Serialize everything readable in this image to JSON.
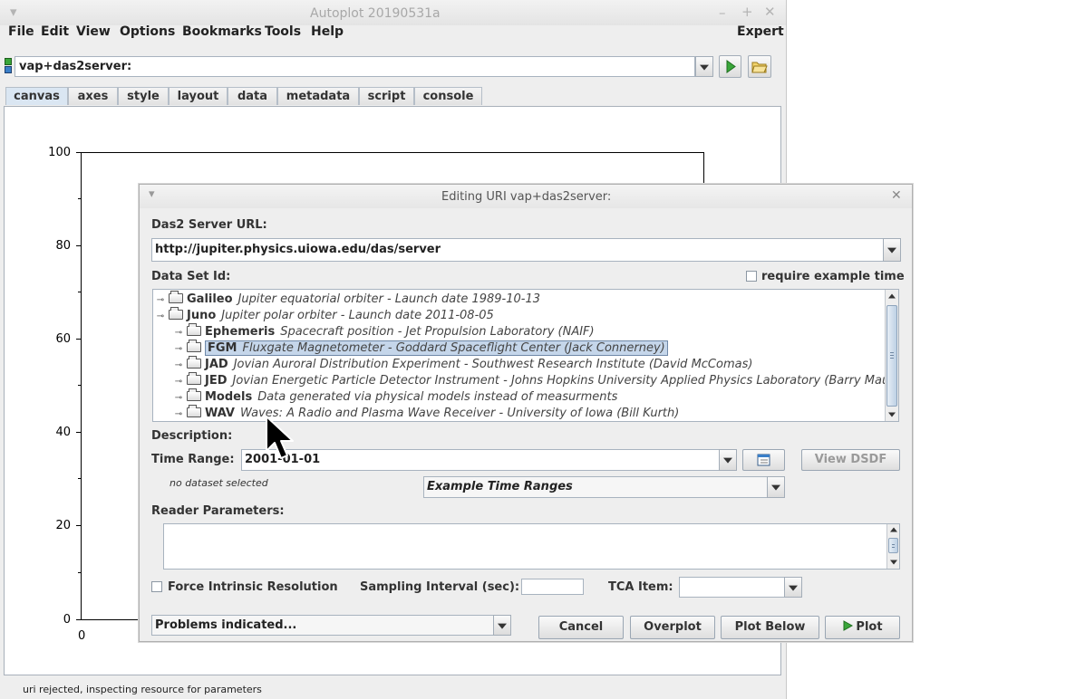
{
  "main_window": {
    "title": "Autoplot 20190531a",
    "menu": [
      "File",
      "Edit",
      "View",
      "Options",
      "Bookmarks",
      "Tools",
      "Help"
    ],
    "expert_label": "Expert",
    "uri_value": "vap+das2server:",
    "tabs": [
      "canvas",
      "axes",
      "style",
      "layout",
      "data",
      "metadata",
      "script",
      "console"
    ],
    "active_tab": "canvas",
    "plot": {
      "y_ticks": [
        "100",
        "80",
        "60",
        "40",
        "20",
        "0"
      ],
      "x_ticks": [
        "0"
      ]
    },
    "status": "uri rejected, inspecting resource for parameters"
  },
  "dialog": {
    "title": "Editing URI vap+das2server:",
    "server_url_label": "Das2 Server URL:",
    "server_url_value": "http://jupiter.physics.uiowa.edu/das/server",
    "dataset_id_label": "Data Set Id:",
    "require_example_time_label": "require example time",
    "tree": [
      {
        "key": "Galileo",
        "desc": "Jupiter equatorial orbiter - Launch date 1989-10-13"
      },
      {
        "key": "Juno",
        "desc": "Jupiter polar orbiter - Launch date 2011-08-05"
      },
      {
        "key": "Ephemeris",
        "desc": "Spacecraft position - Jet Propulsion Laboratory (NAIF)"
      },
      {
        "key": "FGM",
        "desc": "Fluxgate Magnetometer - Goddard Spaceflight Center (Jack Connerney)"
      },
      {
        "key": "JAD",
        "desc": "Jovian Auroral Distribution Experiment - Southwest Research Institute (David McComas)"
      },
      {
        "key": "JED",
        "desc": "Jovian Energetic Particle Detector Instrument - Johns Hopkins University Applied Physics Laboratory (Barry Mauk)"
      },
      {
        "key": "Models",
        "desc": "Data generated via physical models instead of measurments"
      },
      {
        "key": "WAV",
        "desc": "Waves: A Radio and Plasma Wave Receiver - University of Iowa (Bill Kurth)"
      }
    ],
    "description_label": "Description:",
    "time_range_label": "Time Range:",
    "time_range_value": "2001-01-01",
    "view_dsdf_label": "View DSDF",
    "no_dataset_note": "no dataset selected",
    "example_time_ranges": "Example Time Ranges",
    "reader_params_label": "Reader Parameters:",
    "force_intrinsic_label": "Force Intrinsic Resolution",
    "sampling_interval_label": "Sampling Interval (sec):",
    "tca_item_label": "TCA Item:",
    "problems_value": "Problems indicated...",
    "buttons": {
      "cancel": "Cancel",
      "overplot": "Overplot",
      "plot_below": "Plot Below",
      "plot": "Plot"
    }
  }
}
